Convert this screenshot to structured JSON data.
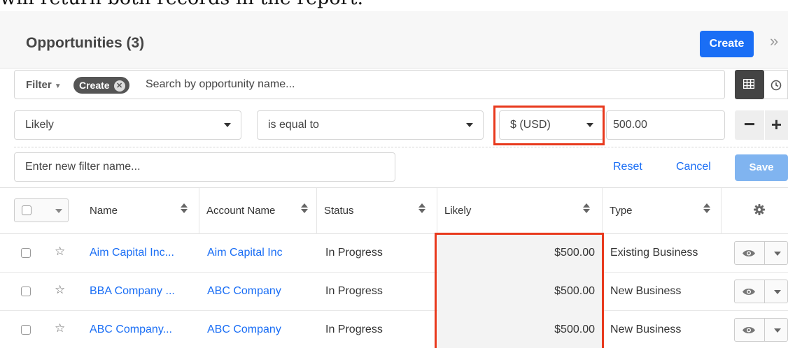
{
  "caption": "will return both records in the report.",
  "header": {
    "title": "Opportunities (3)",
    "create_label": "Create"
  },
  "filter": {
    "dropdown_label": "Filter",
    "pill_label": "Create",
    "search_placeholder": "Search by opportunity name..."
  },
  "row_filter": {
    "field": "Likely",
    "operator": "is equal to",
    "currency": "$ (USD)",
    "value": "500.00"
  },
  "filter_name": {
    "placeholder": "Enter new filter name..."
  },
  "actions": {
    "reset": "Reset",
    "cancel": "Cancel",
    "save": "Save"
  },
  "columns": [
    "Name",
    "Account Name",
    "Status",
    "Likely",
    "Type"
  ],
  "rows": [
    {
      "name": "Aim Capital Inc...",
      "account": "Aim Capital Inc",
      "status": "In Progress",
      "likely": "$500.00",
      "type": "Existing Business"
    },
    {
      "name": "BBA Company ...",
      "account": "ABC Company",
      "status": "In Progress",
      "likely": "$500.00",
      "type": "New Business"
    },
    {
      "name": "ABC Company...",
      "account": "ABC Company",
      "status": "In Progress",
      "likely": "$500.00",
      "type": "New Business"
    }
  ],
  "colors": {
    "accent": "#1a6ef5",
    "highlight": "#e8391d",
    "save_disabled": "#80b4f0"
  },
  "icons": [
    "chevron-double-right-icon",
    "grid-view-icon",
    "clock-icon",
    "remove-circle-icon",
    "sort-icon",
    "gear-icon",
    "star-icon",
    "eye-icon",
    "caret-down-icon"
  ]
}
